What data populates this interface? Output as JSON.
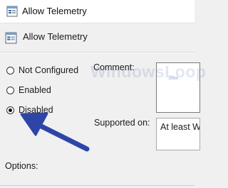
{
  "window": {
    "title": "Allow Telemetry"
  },
  "header": {
    "policy_title": "Allow Telemetry"
  },
  "state_options": [
    {
      "label": "Not Configured",
      "checked": false
    },
    {
      "label": "Enabled",
      "checked": false
    },
    {
      "label": "Disabled",
      "checked": true
    }
  ],
  "comment": {
    "label": "Comment:",
    "value": ""
  },
  "supported_on": {
    "label": "Supported on:",
    "value": "At least W"
  },
  "options": {
    "label": "Options:"
  },
  "watermark": {
    "text": "WindowsLoop",
    "suffix": ".com"
  },
  "colors": {
    "arrow": "#2e45a8",
    "window_bg": "#f0f0f0"
  },
  "icons": [
    "policy-setting-icon",
    "arrow-annotation"
  ]
}
